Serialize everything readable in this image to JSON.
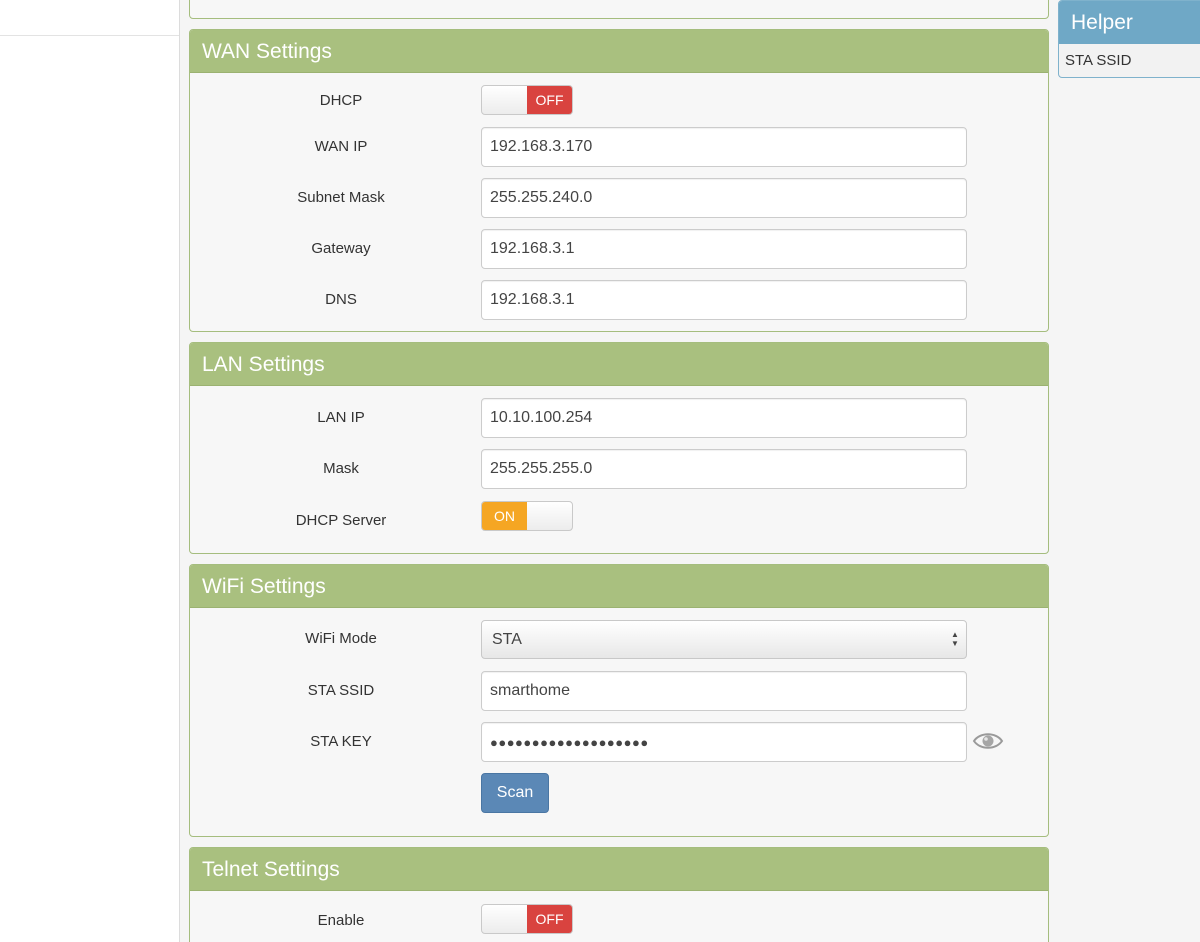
{
  "helper": {
    "title": "Helper",
    "topic": "STA SSID"
  },
  "wan": {
    "title": "WAN Settings",
    "dhcp_label": "DHCP",
    "dhcp_state": "OFF",
    "wan_ip_label": "WAN IP",
    "wan_ip_value": "192.168.3.170",
    "subnet_label": "Subnet Mask",
    "subnet_value": "255.255.240.0",
    "gateway_label": "Gateway",
    "gateway_value": "192.168.3.1",
    "dns_label": "DNS",
    "dns_value": "192.168.3.1"
  },
  "lan": {
    "title": "LAN Settings",
    "lan_ip_label": "LAN IP",
    "lan_ip_value": "10.10.100.254",
    "mask_label": "Mask",
    "mask_value": "255.255.255.0",
    "dhcp_server_label": "DHCP Server",
    "dhcp_server_state": "ON"
  },
  "wifi": {
    "title": "WiFi Settings",
    "mode_label": "WiFi Mode",
    "mode_value": "STA",
    "ssid_label": "STA SSID",
    "ssid_value": "smarthome",
    "key_label": "STA KEY",
    "key_value": "●●●●●●●●●●●●●●●●●●●",
    "scan_label": "Scan"
  },
  "telnet": {
    "title": "Telnet Settings",
    "enable_label": "Enable",
    "enable_state": "OFF"
  },
  "colors": {
    "panel_header": "#a9c07f",
    "helper_header": "#6fa8c6",
    "switch_off": "#d9433f",
    "switch_on": "#f5a623",
    "scan_button": "#5b88b6"
  }
}
